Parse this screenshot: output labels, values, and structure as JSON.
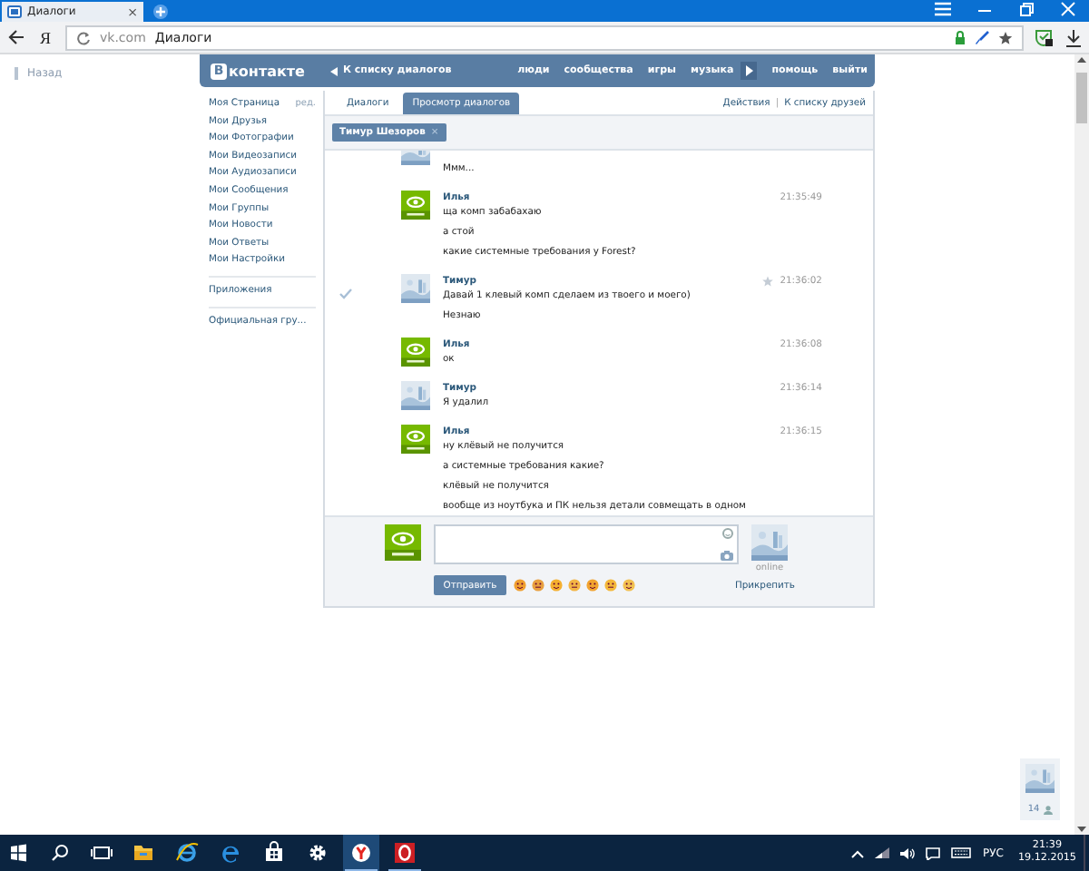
{
  "browser": {
    "tab": {
      "title": "Диалоги",
      "close": "×"
    },
    "yandex_button": "Я",
    "address": {
      "domain": "vk.com",
      "title": "Диалоги"
    }
  },
  "page": {
    "back_link": "Назад"
  },
  "vk_header": {
    "logo_letter": "В",
    "logo_text": "контакте",
    "back_link": "К списку диалогов",
    "nav": [
      {
        "kind": "link",
        "label": "люди"
      },
      {
        "kind": "link",
        "label": "сообщества"
      },
      {
        "kind": "link",
        "label": "игры"
      },
      {
        "kind": "link",
        "label": "музыка"
      },
      {
        "kind": "play"
      },
      {
        "kind": "link",
        "label": "помощь"
      },
      {
        "kind": "link",
        "label": "выйти"
      }
    ]
  },
  "sidebar": {
    "groups": [
      {
        "items": [
          {
            "label": "Моя Страница",
            "edit": "ред."
          },
          {
            "label": "Мои Друзья"
          },
          {
            "label": "Мои Фотографии"
          },
          {
            "label": "Мои Видеозаписи"
          },
          {
            "label": "Мои Аудиозаписи"
          },
          {
            "label": "Мои Сообщения"
          },
          {
            "label": "Мои Группы"
          },
          {
            "label": "Мои Новости"
          },
          {
            "label": "Мои Ответы"
          },
          {
            "label": "Мои Настройки"
          }
        ]
      },
      {
        "items": [
          {
            "label": "Приложения"
          }
        ]
      },
      {
        "items": [
          {
            "label": "Официальная гру..."
          }
        ]
      }
    ]
  },
  "tabs": [
    {
      "label": "Диалоги",
      "selected": false
    },
    {
      "label": "Просмотр диалогов",
      "selected": true
    }
  ],
  "actions": {
    "left": "Действия",
    "separator": "|",
    "right": "К списку друзей"
  },
  "chip": {
    "label": "Тимур Шезоров",
    "close": "×"
  },
  "messages": [
    {
      "kind": "partner",
      "lines": [
        "Ммм..."
      ],
      "checked": false,
      "starred": false
    },
    {
      "author": "Илья",
      "kind": "own",
      "time": "21:35:49",
      "lines": [
        "ща комп забабахаю",
        "а стой",
        "какие системные требования у Forest?"
      ],
      "checked": false,
      "starred": false
    },
    {
      "author": "Тимур",
      "kind": "partner",
      "time": "21:36:02",
      "lines": [
        "Давай 1 клевый комп сделаем из твоего и моего)",
        "Незнаю"
      ],
      "checked": true,
      "starred": true
    },
    {
      "author": "Илья",
      "kind": "own",
      "time": "21:36:08",
      "lines": [
        "ок"
      ],
      "checked": false,
      "starred": false
    },
    {
      "author": "Тимур",
      "kind": "partner",
      "time": "21:36:14",
      "lines": [
        "Я удалил"
      ],
      "checked": false,
      "starred": false
    },
    {
      "author": "Илья",
      "kind": "own",
      "time": "21:36:15",
      "lines": [
        "ну клёвый не получится",
        "а системные требования какие?",
        "клёвый не получится",
        "вообще из ноутбука и ПК нельзя детали совмещать в одном"
      ],
      "checked": false,
      "starred": false
    }
  ],
  "compose": {
    "send_button": "Отправить",
    "attach_link": "Прикрепить",
    "status": "online"
  },
  "chat_widget": {
    "count": "14"
  },
  "taskbar": {
    "apps": [
      {
        "kind": "explorer",
        "selected": false,
        "running": false
      },
      {
        "kind": "ie",
        "selected": false,
        "running": false
      },
      {
        "kind": "edge",
        "selected": false,
        "running": false
      },
      {
        "kind": "store",
        "selected": false,
        "running": false
      },
      {
        "kind": "settings",
        "selected": false,
        "running": false
      },
      {
        "kind": "yandex",
        "selected": true,
        "running": true
      },
      {
        "kind": "opera",
        "selected": false,
        "running": true
      }
    ],
    "language": "РУС",
    "time": "21:39",
    "date": "19.12.2015"
  }
}
